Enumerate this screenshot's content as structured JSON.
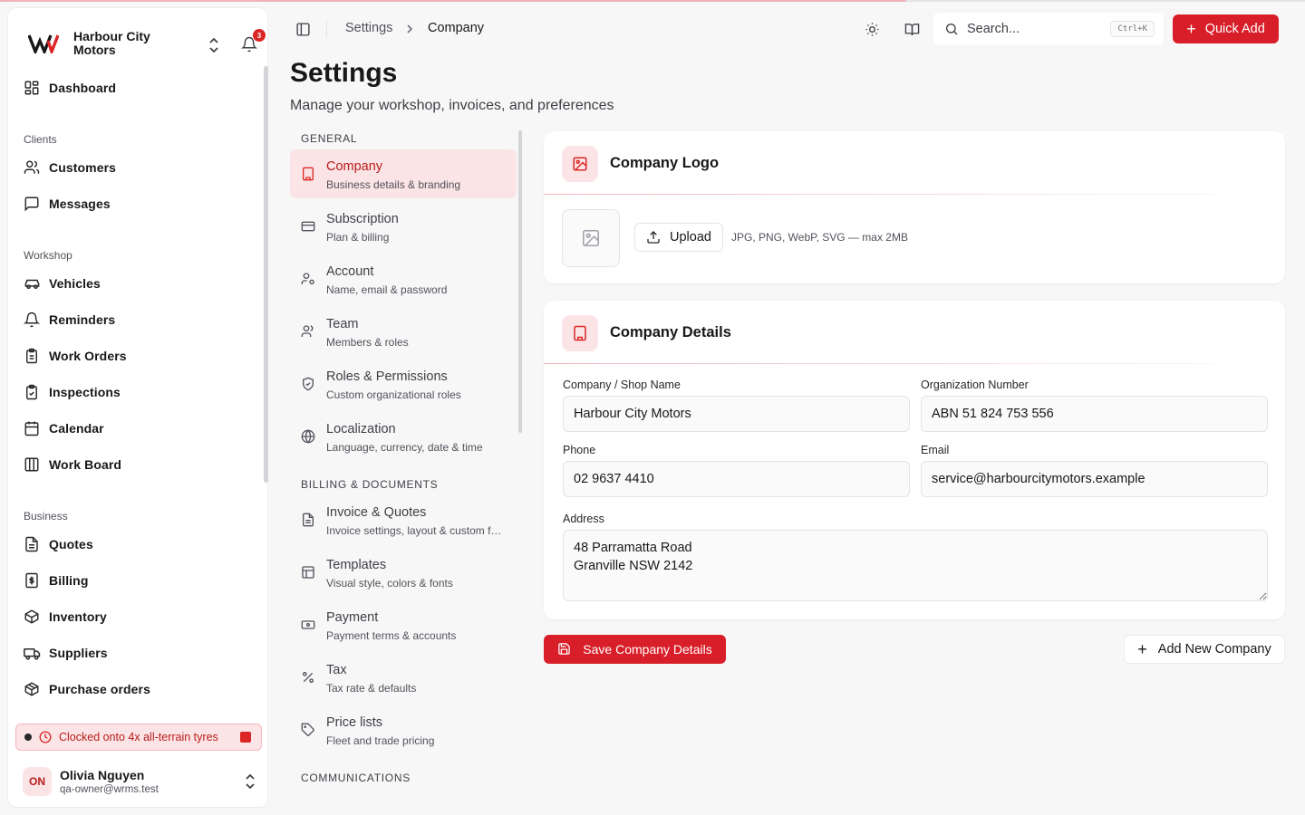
{
  "brand": {
    "name": "Harbour City Motors",
    "notification_count": "3"
  },
  "sidebar": {
    "top_items": [
      {
        "label": "Dashboard",
        "icon": "dashboard-icon"
      }
    ],
    "sections": [
      {
        "title": "Clients",
        "items": [
          {
            "label": "Customers",
            "icon": "users-icon"
          },
          {
            "label": "Messages",
            "icon": "message-icon"
          }
        ]
      },
      {
        "title": "Workshop",
        "items": [
          {
            "label": "Vehicles",
            "icon": "car-icon"
          },
          {
            "label": "Reminders",
            "icon": "bell-icon"
          },
          {
            "label": "Work Orders",
            "icon": "clipboard-icon"
          },
          {
            "label": "Inspections",
            "icon": "clipboard-check-icon"
          },
          {
            "label": "Calendar",
            "icon": "calendar-icon"
          },
          {
            "label": "Work Board",
            "icon": "columns-icon"
          }
        ]
      },
      {
        "title": "Business",
        "items": [
          {
            "label": "Quotes",
            "icon": "document-icon"
          },
          {
            "label": "Billing",
            "icon": "dollar-icon"
          },
          {
            "label": "Inventory",
            "icon": "box-icon"
          },
          {
            "label": "Suppliers",
            "icon": "truck-icon"
          },
          {
            "label": "Purchase orders",
            "icon": "package-icon"
          }
        ]
      }
    ],
    "clock_banner": "Clocked onto 4x all-terrain tyres",
    "user": {
      "initials": "ON",
      "name": "Olivia Nguyen",
      "email": "qa-owner@wrms.test"
    }
  },
  "header": {
    "breadcrumb": [
      "Settings",
      "Company"
    ],
    "search_placeholder": "Search...",
    "search_shortcut": "Ctrl+K",
    "quick_add": "Quick Add"
  },
  "page": {
    "title": "Settings",
    "subtitle": "Manage your workshop, invoices, and preferences"
  },
  "settings_nav": {
    "groups": [
      {
        "heading": "GENERAL",
        "items": [
          {
            "title": "Company",
            "subtitle": "Business details & branding",
            "active": true
          },
          {
            "title": "Subscription",
            "subtitle": "Plan & billing"
          },
          {
            "title": "Account",
            "subtitle": "Name, email & password"
          },
          {
            "title": "Team",
            "subtitle": "Members & roles"
          },
          {
            "title": "Roles & Permissions",
            "subtitle": "Custom organizational roles"
          },
          {
            "title": "Localization",
            "subtitle": "Language, currency, date & time"
          }
        ]
      },
      {
        "heading": "BILLING & DOCUMENTS",
        "items": [
          {
            "title": "Invoice & Quotes",
            "subtitle": "Invoice settings, layout & custom fields"
          },
          {
            "title": "Templates",
            "subtitle": "Visual style, colors & fonts"
          },
          {
            "title": "Payment",
            "subtitle": "Payment terms & accounts"
          },
          {
            "title": "Tax",
            "subtitle": "Tax rate & defaults"
          },
          {
            "title": "Price lists",
            "subtitle": "Fleet and trade pricing"
          }
        ]
      },
      {
        "heading": "COMMUNICATIONS",
        "items": []
      }
    ]
  },
  "logo_card": {
    "title": "Company Logo",
    "upload_label": "Upload",
    "hint": "JPG, PNG, WebP, SVG — max 2MB"
  },
  "details_card": {
    "title": "Company Details",
    "fields": {
      "company_name": {
        "label": "Company / Shop Name",
        "value": "Harbour City Motors"
      },
      "org_number": {
        "label": "Organization Number",
        "value": "ABN 51 824 753 556"
      },
      "phone": {
        "label": "Phone",
        "value": "02 9637 4410"
      },
      "email": {
        "label": "Email",
        "value": "service@harbourcitymotors.example"
      },
      "address": {
        "label": "Address",
        "value": "48 Parramatta Road\nGranville NSW 2142"
      }
    }
  },
  "actions": {
    "save": "Save Company Details",
    "add_company": "Add New Company"
  },
  "colors": {
    "accent": "#d81e28",
    "accent_soft": "#fbe4e5"
  }
}
